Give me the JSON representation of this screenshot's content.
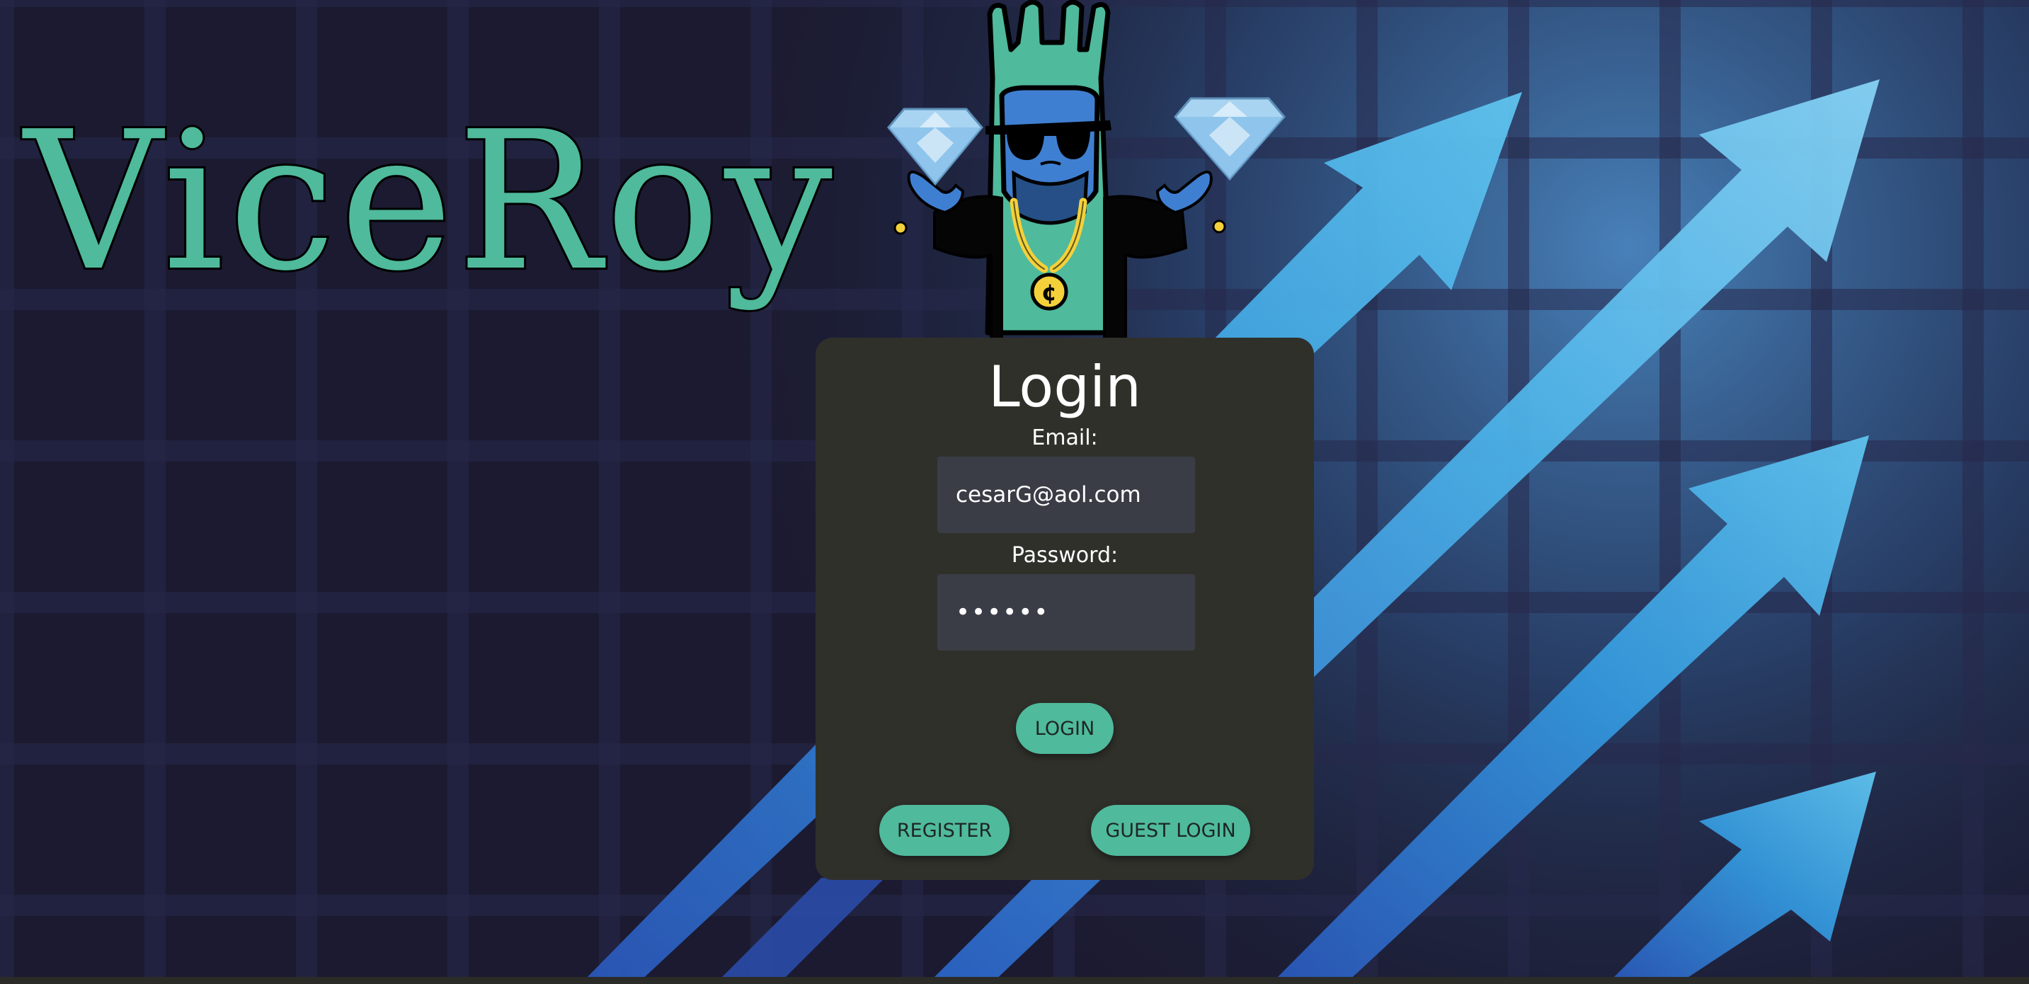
{
  "brand": {
    "name": "ViceRoy"
  },
  "mascot": {
    "icon": "viceroy-mascot-icon",
    "coin_symbol": "¢"
  },
  "login": {
    "title": "Login",
    "email_label": "Email:",
    "email_value": "cesarG@aol.com",
    "password_label": "Password:",
    "password_value": "••••••",
    "login_button": "LOGIN",
    "register_button": "REGISTER",
    "guest_button": "GUEST LOGIN"
  },
  "colors": {
    "accent": "#4fba9c",
    "background": "#1b1a30",
    "card": "#30302b",
    "input": "#3b3d46",
    "arrows": "#3aa0e0"
  }
}
